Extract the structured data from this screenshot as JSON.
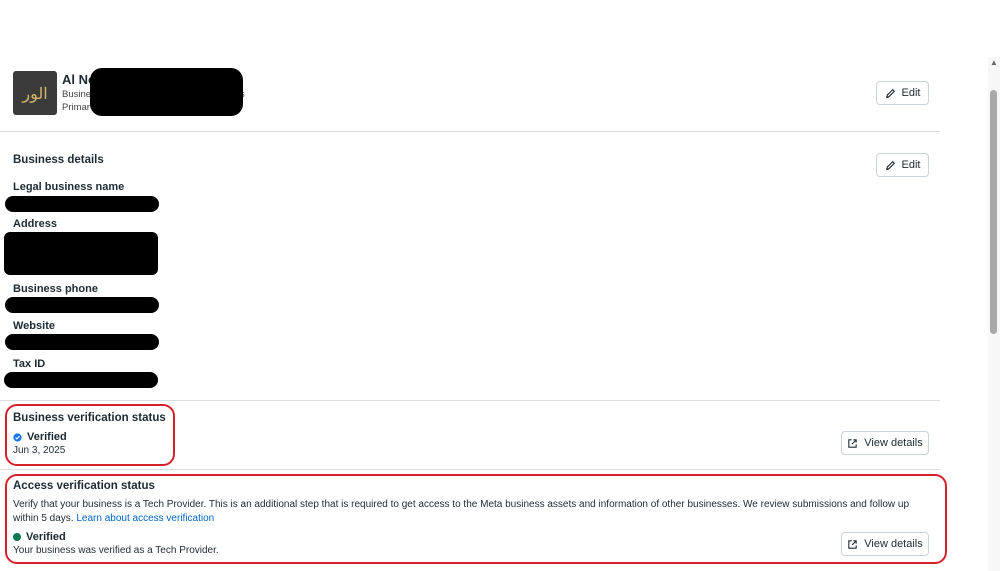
{
  "profile": {
    "name": "Al No",
    "line1": "Busine",
    "line1_tail": "s",
    "line2": "Primar",
    "logo_text": "الور"
  },
  "edit_label": "Edit",
  "business_details": {
    "title": "Business details",
    "legal_name_label": "Legal business name",
    "address_label": "Address",
    "phone_label": "Business phone",
    "website_label": "Website",
    "tax_label": "Tax ID"
  },
  "business_verification": {
    "title": "Business verification status",
    "status": "Verified",
    "date": "Jun 3, 2025",
    "button": "View details",
    "status_color": "#1877f2"
  },
  "access_verification": {
    "title": "Access verification status",
    "description": "Verify that your business is a Tech Provider. This is an additional step that is required to get access to the Meta business assets and information of other businesses. We review submissions and follow up within 5 days.",
    "link": "Learn about access verification",
    "status": "Verified",
    "status_note": "Your business was verified as a Tech Provider.",
    "button": "View details",
    "status_color": "#0a7a50"
  },
  "icons": {
    "edit": "pencil-icon",
    "view": "external-link-icon",
    "verified": "check-badge-icon"
  }
}
